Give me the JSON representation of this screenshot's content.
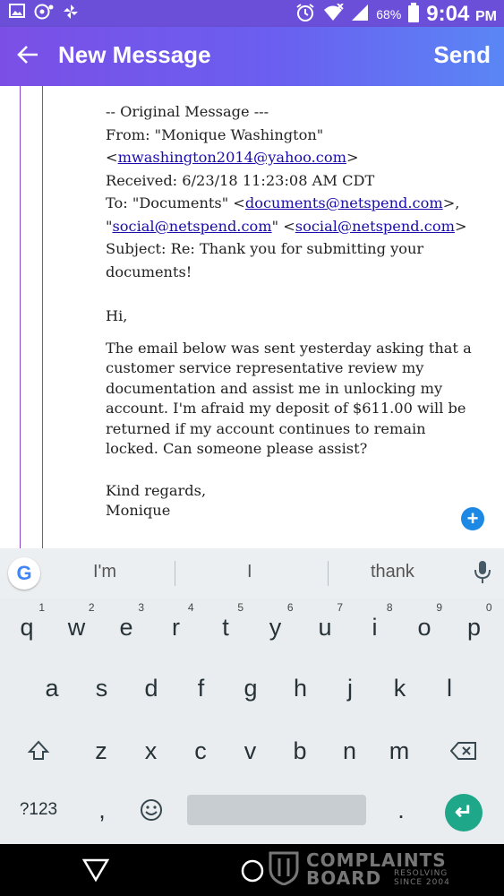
{
  "status_bar": {
    "battery": "68%",
    "time": "9:04",
    "ampm": "PM"
  },
  "app_bar": {
    "title": "New Message",
    "send_label": "Send"
  },
  "message": {
    "header_lines": [
      "-- Original Message ---",
      "From: \"Monique Washington\""
    ],
    "from_email": "mwashington2014@yahoo.com",
    "received": "Received: 6/23/18 11:23:08 AM CDT",
    "to_prefix": "To: \"Documents\" <",
    "to_email": "documents@netspend.com",
    "to_suffix": ">,",
    "cc_quote_open": "\"",
    "cc_email_1": "social@netspend.com",
    "cc_quote_close": "\" <",
    "cc_email_2": "social@netspend.com",
    "cc_end": ">",
    "subject_line1": "Subject: Re: Thank you for submitting your",
    "subject_line2": "documents!",
    "greeting": "Hi,",
    "body_lines": [
      "The email below was sent yesterday asking that a",
      "customer service representative review my",
      "documentation and assist me in unlocking my",
      "account. I'm afraid my deposit of $611.00 will be",
      "returned if my account continues to remain",
      "locked. Can someone please assist?"
    ],
    "closing": "Kind regards,",
    "signature": "Monique"
  },
  "keyboard": {
    "suggestions": [
      "I'm",
      "I",
      "thank"
    ],
    "row1": [
      {
        "k": "q",
        "n": "1"
      },
      {
        "k": "w",
        "n": "2"
      },
      {
        "k": "e",
        "n": "3"
      },
      {
        "k": "r",
        "n": "4"
      },
      {
        "k": "t",
        "n": "5"
      },
      {
        "k": "y",
        "n": "6"
      },
      {
        "k": "u",
        "n": "7"
      },
      {
        "k": "i",
        "n": "8"
      },
      {
        "k": "o",
        "n": "9"
      },
      {
        "k": "p",
        "n": "0"
      }
    ],
    "row2": [
      "a",
      "s",
      "d",
      "f",
      "g",
      "h",
      "j",
      "k",
      "l"
    ],
    "row3": [
      "z",
      "x",
      "c",
      "v",
      "b",
      "n",
      "m"
    ],
    "symbols_label": "?123",
    "comma": ",",
    "period": "."
  },
  "watermark": {
    "line1": "COMPLAINTS",
    "line2": "BOARD",
    "tag1": "RESOLVING",
    "tag2": "SINCE 2004"
  },
  "icons": [
    "image-icon",
    "chat-icon",
    "pinwheel-icon",
    "alarm-icon",
    "wifi-icon",
    "signal-icon",
    "battery-icon",
    "back-arrow-icon",
    "add-icon",
    "google-icon",
    "mic-icon",
    "shift-icon",
    "backspace-icon",
    "emoji-icon",
    "enter-icon",
    "nav-back-icon",
    "nav-home-icon"
  ]
}
